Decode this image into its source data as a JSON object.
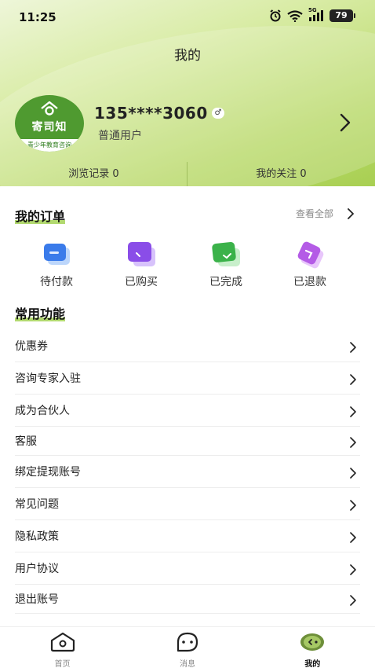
{
  "status_bar": {
    "time": "11:25",
    "network": "5G",
    "battery": "79"
  },
  "header": {
    "title": "我的"
  },
  "profile": {
    "avatar_text": "寄司知",
    "avatar_subtext": "青少年教育咨询",
    "username": "135****3060",
    "gender_symbol": "♂",
    "user_type": "普通用户"
  },
  "stats": {
    "history_label": "浏览记录 0",
    "following_label": "我的关注 0"
  },
  "orders": {
    "title": "我的订单",
    "view_all": "查看全部",
    "items": [
      {
        "label": "待付款",
        "icon": "wallet-icon",
        "color": "#3a7bea"
      },
      {
        "label": "已购买",
        "icon": "purchased-icon",
        "color": "#8a4de8"
      },
      {
        "label": "已完成",
        "icon": "completed-icon",
        "color": "#3bb24a"
      },
      {
        "label": "已退款",
        "icon": "refund-icon",
        "color": "#b45be6"
      }
    ]
  },
  "common": {
    "title": "常用功能",
    "items": [
      {
        "label": "优惠券"
      },
      {
        "label": "咨询专家入驻"
      },
      {
        "label": "成为合伙人"
      },
      {
        "label": "客服"
      },
      {
        "label": "绑定提现账号"
      },
      {
        "label": "常见问题"
      },
      {
        "label": "隐私政策"
      },
      {
        "label": "用户协议"
      },
      {
        "label": "退出账号"
      }
    ]
  },
  "tabbar": {
    "items": [
      {
        "label": "首页",
        "icon": "home-icon",
        "active": false
      },
      {
        "label": "消息",
        "icon": "message-icon",
        "active": false
      },
      {
        "label": "我的",
        "icon": "profile-icon",
        "active": true
      }
    ]
  },
  "colors": {
    "accent": "#9fd04c",
    "hero_start": "#eef6d9",
    "hero_end": "#a8cf52"
  }
}
